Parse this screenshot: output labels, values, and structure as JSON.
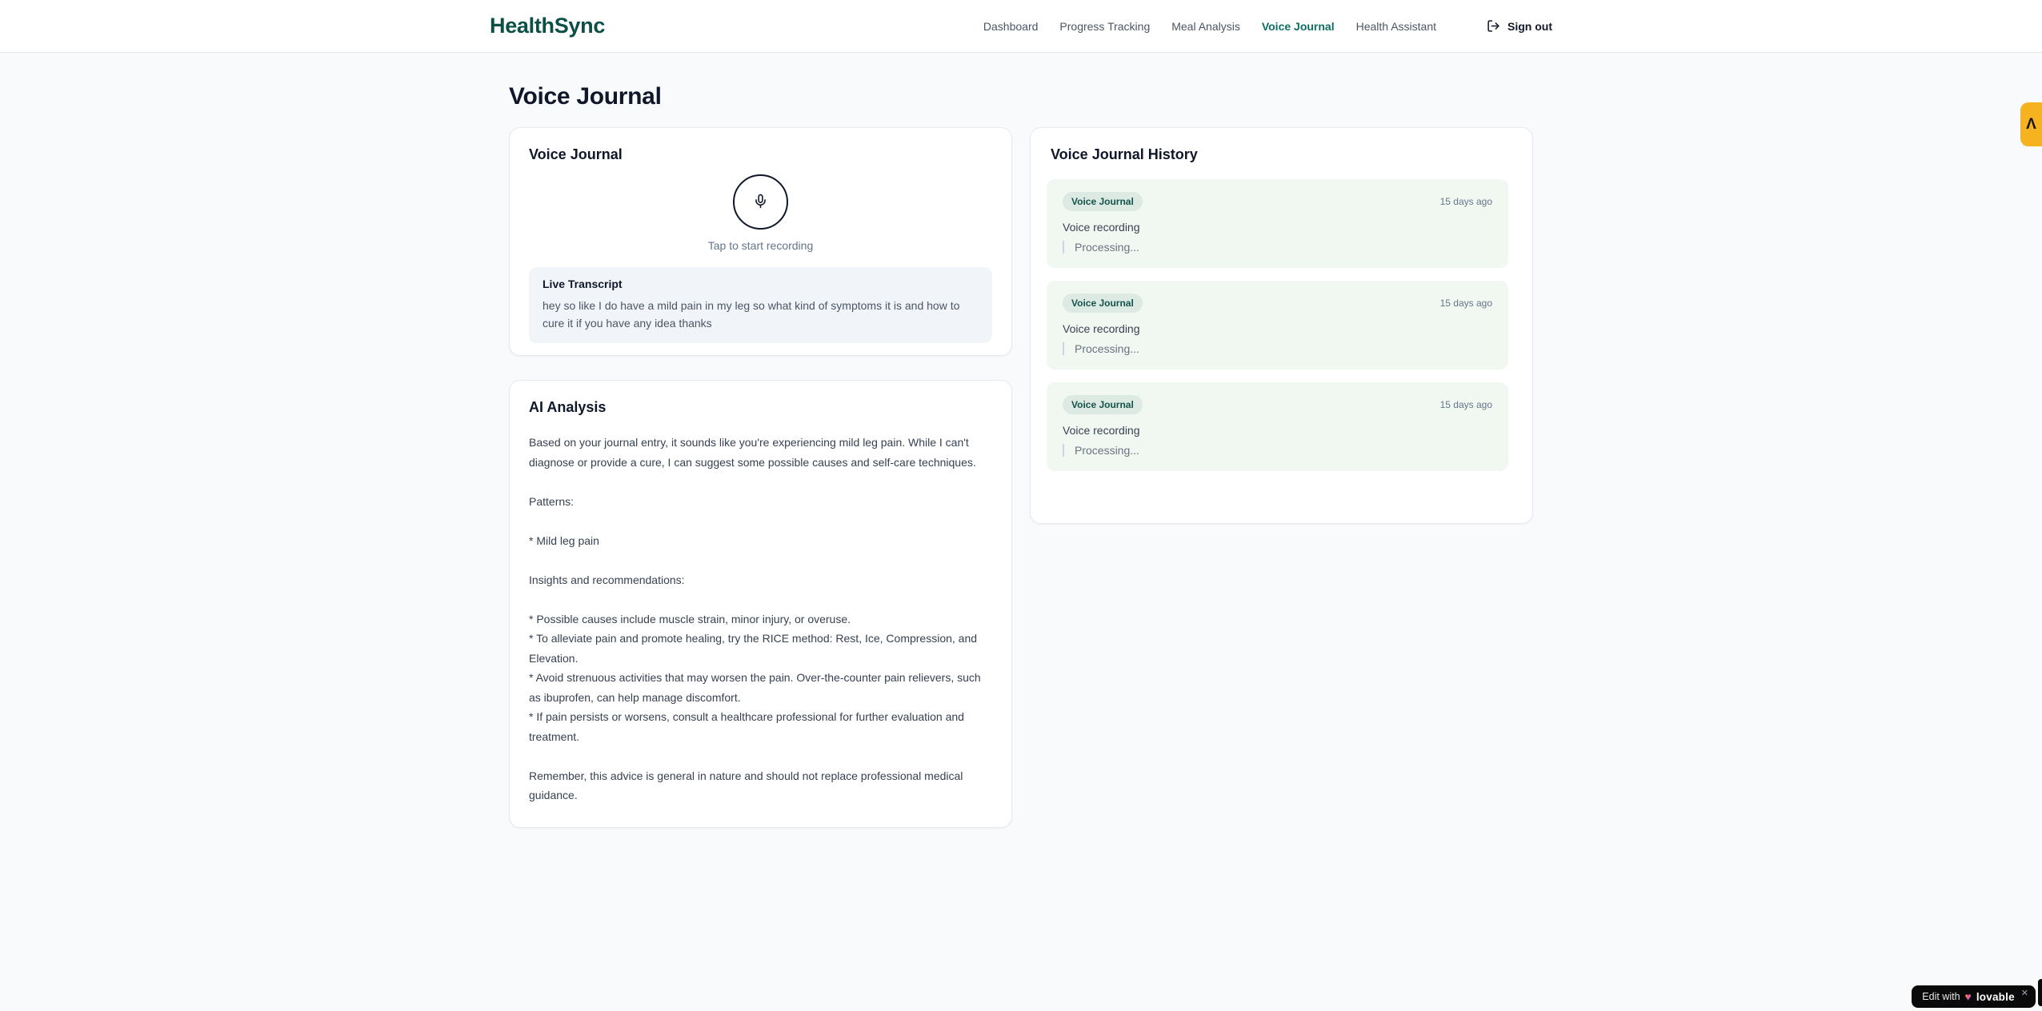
{
  "header": {
    "logo": "HealthSync",
    "nav": [
      {
        "label": "Dashboard",
        "active": false
      },
      {
        "label": "Progress Tracking",
        "active": false
      },
      {
        "label": "Meal Analysis",
        "active": false
      },
      {
        "label": "Voice Journal",
        "active": true
      },
      {
        "label": "Health Assistant",
        "active": false
      }
    ],
    "signout_label": "Sign out"
  },
  "page": {
    "title": "Voice Journal"
  },
  "recorder_card": {
    "title": "Voice Journal",
    "tap_label": "Tap to start recording",
    "transcript": {
      "title": "Live Transcript",
      "text": "hey so like I do have a mild pain in my leg so what kind of symptoms it is and how to cure it if you have any idea thanks"
    }
  },
  "analysis_card": {
    "title": "AI Analysis",
    "body": "Based on your journal entry, it sounds like you're experiencing mild leg pain. While I can't diagnose or provide a cure, I can suggest some possible causes and self-care techniques.\n\nPatterns:\n\n* Mild leg pain\n\nInsights and recommendations:\n\n* Possible causes include muscle strain, minor injury, or overuse.\n* To alleviate pain and promote healing, try the RICE method: Rest, Ice, Compression, and Elevation.\n* Avoid strenuous activities that may worsen the pain. Over-the-counter pain relievers, such as ibuprofen, can help manage discomfort.\n* If pain persists or worsens, consult a healthcare professional for further evaluation and treatment.\n\nRemember, this advice is general in nature and should not replace professional medical guidance."
  },
  "history_card": {
    "title": "Voice Journal History",
    "items": [
      {
        "badge": "Voice Journal",
        "time": "15 days ago",
        "desc": "Voice recording",
        "status": "Processing..."
      },
      {
        "badge": "Voice Journal",
        "time": "15 days ago",
        "desc": "Voice recording",
        "status": "Processing..."
      },
      {
        "badge": "Voice Journal",
        "time": "15 days ago",
        "desc": "Voice recording",
        "status": "Processing..."
      }
    ]
  },
  "widgets": {
    "corner_tab_glyph": "Λ",
    "edit_badge": {
      "prefix": "Edit with",
      "heart_glyph": "♥",
      "brand": "lovable",
      "close_glyph": "✕"
    }
  },
  "colors": {
    "accent_teal": "#0b4f47",
    "nav_active": "#0e6e63",
    "history_item_bg": "#f1f8f2",
    "badge_bg": "#dde9e3",
    "badge_text": "#14544a",
    "transcript_bg": "#f1f5f9",
    "corner_tab_bg": "#f6b21f",
    "page_bg": "#f8fafc"
  }
}
